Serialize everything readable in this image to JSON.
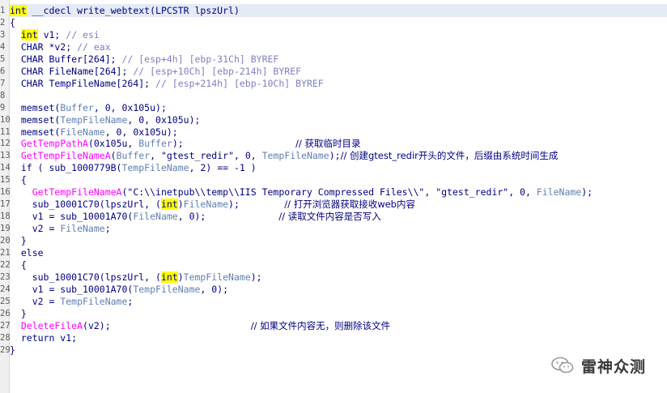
{
  "editor": {
    "lines": [
      {
        "n": "1",
        "segs": [
          [
            "hl",
            "int"
          ],
          [
            "kw",
            " __cdecl write_webtext(LPCSTR lpszUrl)"
          ]
        ]
      },
      {
        "n": "2",
        "segs": [
          [
            "kw",
            "{"
          ]
        ]
      },
      {
        "n": "3",
        "segs": [
          [
            "kw",
            "  "
          ],
          [
            "hl",
            "int"
          ],
          [
            "kw",
            " v1; "
          ],
          [
            "cm",
            "// esi"
          ]
        ]
      },
      {
        "n": "4",
        "segs": [
          [
            "kw",
            "  CHAR *v2; "
          ],
          [
            "cm",
            "// eax"
          ]
        ]
      },
      {
        "n": "5",
        "segs": [
          [
            "kw",
            "  CHAR Buffer[264]; "
          ],
          [
            "cm",
            "// [esp+4h] [ebp-31Ch] BYREF"
          ]
        ]
      },
      {
        "n": "6",
        "segs": [
          [
            "kw",
            "  CHAR FileName[264]; "
          ],
          [
            "cm",
            "// [esp+10Ch] [ebp-214h] BYREF"
          ]
        ]
      },
      {
        "n": "7",
        "segs": [
          [
            "kw",
            "  CHAR TempFileName[264]; "
          ],
          [
            "cm",
            "// [esp+214h] [ebp-10Ch] BYREF"
          ]
        ]
      },
      {
        "n": "8",
        "segs": []
      },
      {
        "n": "9",
        "segs": [
          [
            "kw",
            "  memset("
          ],
          [
            "gv",
            "Buffer"
          ],
          [
            "kw",
            ", 0, 0x105u);"
          ]
        ]
      },
      {
        "n": "10",
        "segs": [
          [
            "kw",
            "  memset("
          ],
          [
            "gv",
            "TempFileName"
          ],
          [
            "kw",
            ", 0, 0x105u);"
          ]
        ]
      },
      {
        "n": "11",
        "segs": [
          [
            "kw",
            "  memset("
          ],
          [
            "gv",
            "FileName"
          ],
          [
            "kw",
            ", 0, 0x105u);"
          ]
        ]
      },
      {
        "n": "12",
        "segs": [
          [
            "kw",
            "  "
          ],
          [
            "fn",
            "GetTempPathA"
          ],
          [
            "kw",
            "(0x105u, "
          ],
          [
            "gv",
            "Buffer"
          ],
          [
            "kw",
            ");                    "
          ],
          [
            "cn",
            "// 获取临时目录"
          ]
        ]
      },
      {
        "n": "13",
        "segs": [
          [
            "kw",
            "  "
          ],
          [
            "fn",
            "GetTempFileNameA"
          ],
          [
            "kw",
            "("
          ],
          [
            "gv",
            "Buffer"
          ],
          [
            "kw",
            ", "
          ],
          [
            "str",
            "\"gtest_redir\""
          ],
          [
            "kw",
            ", 0, "
          ],
          [
            "gv",
            "TempFileName"
          ],
          [
            "kw",
            ");"
          ],
          [
            "cn",
            "// 创建gtest_redir开头的文件，后缀由系统时间生成"
          ]
        ]
      },
      {
        "n": "14",
        "segs": [
          [
            "kw",
            "  if ( sub_1000779B("
          ],
          [
            "gv",
            "TempFileName"
          ],
          [
            "kw",
            ", 2) == -1 )"
          ]
        ]
      },
      {
        "n": "15",
        "segs": [
          [
            "kw",
            "  {"
          ]
        ]
      },
      {
        "n": "16",
        "segs": [
          [
            "kw",
            "    "
          ],
          [
            "fn",
            "GetTempFileNameA"
          ],
          [
            "kw",
            "(\"C:\\\\inetpub\\\\temp\\\\IIS Temporary Compressed Files\\\\\", \"gtest_redir\", 0, "
          ],
          [
            "gv",
            "FileName"
          ],
          [
            "kw",
            ");"
          ]
        ]
      },
      {
        "n": "17",
        "segs": [
          [
            "kw",
            "    sub_10001C70(lpszUrl, ("
          ],
          [
            "hl",
            "int"
          ],
          [
            "kw",
            ")"
          ],
          [
            "gv",
            "FileName"
          ],
          [
            "kw",
            ");        "
          ],
          [
            "cn",
            "// 打开浏览器获取接收web内容"
          ]
        ]
      },
      {
        "n": "18",
        "segs": [
          [
            "kw",
            "    v1 = sub_10001A70("
          ],
          [
            "gv",
            "FileName"
          ],
          [
            "kw",
            ", 0);             "
          ],
          [
            "cn",
            "// 读取文件内容是否写入"
          ]
        ]
      },
      {
        "n": "19",
        "segs": [
          [
            "kw",
            "    v2 = "
          ],
          [
            "gv",
            "FileName"
          ],
          [
            "kw",
            ";"
          ]
        ]
      },
      {
        "n": "20",
        "segs": [
          [
            "kw",
            "  }"
          ]
        ]
      },
      {
        "n": "21",
        "segs": [
          [
            "kw",
            "  else"
          ]
        ]
      },
      {
        "n": "22",
        "segs": [
          [
            "kw",
            "  {"
          ]
        ]
      },
      {
        "n": "23",
        "segs": [
          [
            "kw",
            "    sub_10001C70(lpszUrl, ("
          ],
          [
            "hl",
            "int"
          ],
          [
            "kw",
            ")"
          ],
          [
            "gv",
            "TempFileName"
          ],
          [
            "kw",
            ");"
          ]
        ]
      },
      {
        "n": "24",
        "segs": [
          [
            "kw",
            "    v1 = sub_10001A70("
          ],
          [
            "gv",
            "TempFileName"
          ],
          [
            "kw",
            ", 0);"
          ]
        ]
      },
      {
        "n": "25",
        "segs": [
          [
            "kw",
            "    v2 = "
          ],
          [
            "gv",
            "TempFileName"
          ],
          [
            "kw",
            ";"
          ]
        ]
      },
      {
        "n": "26",
        "segs": [
          [
            "kw",
            "  }"
          ]
        ]
      },
      {
        "n": "27",
        "segs": [
          [
            "kw",
            "  "
          ],
          [
            "fn",
            "DeleteFileA"
          ],
          [
            "kw",
            "(v2);                         "
          ],
          [
            "cn",
            "// 如果文件内容无，则删除该文件"
          ]
        ]
      },
      {
        "n": "28",
        "segs": [
          [
            "kw",
            "  return v1;"
          ]
        ]
      },
      {
        "n": "29",
        "segs": [
          [
            "kw",
            "}"
          ]
        ]
      }
    ]
  },
  "watermark": {
    "text": "雷神众测",
    "icon": "wechat-icon"
  },
  "colors": {
    "keyword": "#000080",
    "highlight": "#ffff00",
    "function": "#ff00ff",
    "variable": "#5f7fb0",
    "comment": "#8080c0"
  }
}
